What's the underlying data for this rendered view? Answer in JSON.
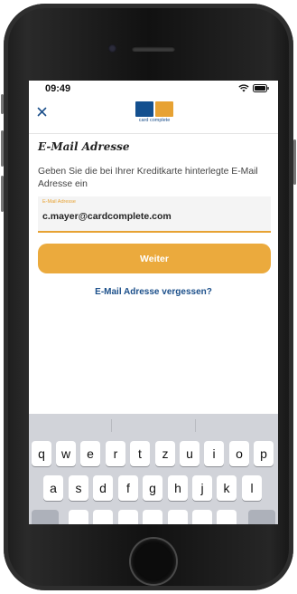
{
  "status_bar": {
    "time": "09:49"
  },
  "nav": {
    "close_icon": "close-icon",
    "logo_text": "card complete"
  },
  "brand_colors": {
    "blue": "#14508f",
    "orange": "#e7a233"
  },
  "form": {
    "title": "E-Mail Adresse",
    "subtitle": "Geben Sie die bei Ihrer Kreditkarte hinterlegte E-Mail Adresse ein",
    "email_label": "E-Mail Adresse",
    "email_value": "c.mayer@cardcomplete.com",
    "submit_label": "Weiter",
    "forgot_link": "E-Mail Adresse vergessen?"
  },
  "keyboard": {
    "row1": [
      "q",
      "w",
      "e",
      "r",
      "t",
      "z",
      "u",
      "i",
      "o",
      "p"
    ],
    "row2": [
      "a",
      "s",
      "d",
      "f",
      "g",
      "h",
      "j",
      "k",
      "l"
    ]
  }
}
